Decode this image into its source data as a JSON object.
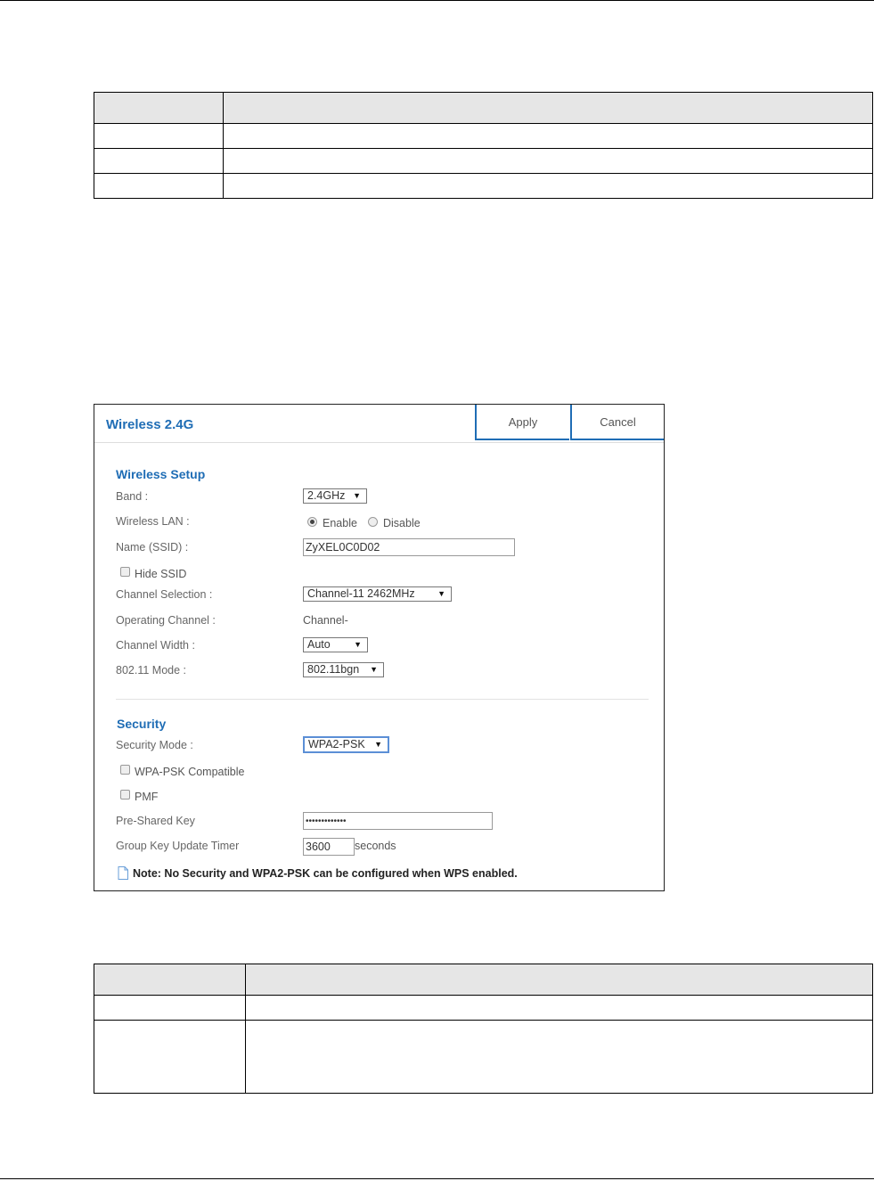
{
  "panel": {
    "title": "Wireless 2.4G",
    "apply_label": "Apply",
    "cancel_label": "Cancel"
  },
  "wireless_setup": {
    "heading": "Wireless Setup",
    "band_label": "Band :",
    "band_value": "2.4GHz",
    "wlan_label": "Wireless LAN :",
    "enable_label": "Enable",
    "disable_label": "Disable",
    "ssid_label": "Name (SSID) :",
    "ssid_value": "ZyXEL0C0D02",
    "hide_ssid_label": "Hide SSID",
    "channel_selection_label": "Channel Selection :",
    "channel_selection_value": "Channel-11 2462MHz",
    "operating_channel_label": "Operating Channel :",
    "operating_channel_value": "Channel-",
    "channel_width_label": "Channel Width :",
    "channel_width_value": "Auto",
    "mode_label": "802.11 Mode :",
    "mode_value": "802.11bgn"
  },
  "security": {
    "heading": "Security",
    "mode_label": "Security Mode :",
    "mode_value": "WPA2-PSK",
    "wpa_psk_compat_label": "WPA-PSK Compatible",
    "pmf_label": "PMF",
    "psk_label": "Pre-Shared Key",
    "psk_value": "•••••••••••••",
    "timer_label": "Group Key Update Timer",
    "timer_value": "3600",
    "timer_unit": "seconds"
  },
  "note": "Note: No Security and WPA2-PSK can be configured when WPS enabled."
}
